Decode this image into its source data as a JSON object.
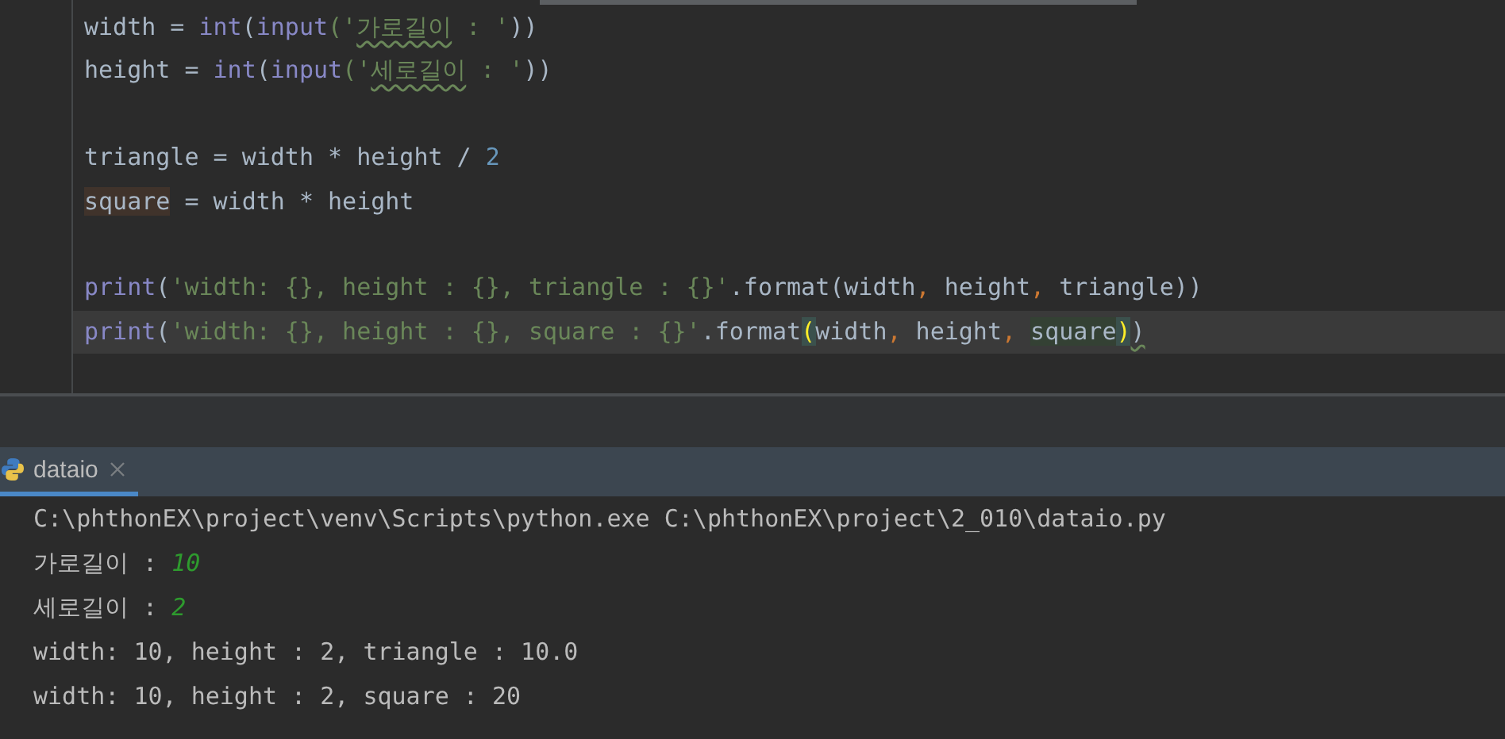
{
  "editor": {
    "blocks": [
      [
        {
          "current": false,
          "tokens": [
            {
              "text": "width",
              "kind": "ident"
            },
            {
              "text": " = ",
              "kind": "ident"
            },
            {
              "text": "int",
              "kind": "builtin"
            },
            {
              "text": "(",
              "kind": "ident"
            },
            {
              "text": "input",
              "kind": "builtin"
            },
            {
              "text": "('",
              "kind": "str"
            },
            {
              "text": "가로길이",
              "kind": "typo"
            },
            {
              "text": " : '",
              "kind": "str"
            },
            {
              "text": "))",
              "kind": "ident"
            }
          ]
        },
        {
          "current": false,
          "tokens": [
            {
              "text": "height",
              "kind": "ident"
            },
            {
              "text": " = ",
              "kind": "ident"
            },
            {
              "text": "int",
              "kind": "builtin"
            },
            {
              "text": "(",
              "kind": "ident"
            },
            {
              "text": "input",
              "kind": "builtin"
            },
            {
              "text": "('",
              "kind": "str"
            },
            {
              "text": "세로길이",
              "kind": "typo"
            },
            {
              "text": " : '",
              "kind": "str"
            },
            {
              "text": "))",
              "kind": "ident"
            }
          ]
        }
      ],
      [
        {
          "current": false,
          "tokens": [
            {
              "text": "triangle = width * height / ",
              "kind": "ident"
            },
            {
              "text": "2",
              "kind": "num"
            }
          ]
        },
        {
          "current": false,
          "tokens": [
            {
              "text": "square",
              "kind": "write"
            },
            {
              "text": " = width * height",
              "kind": "ident"
            }
          ]
        }
      ],
      [
        {
          "current": false,
          "tokens": [
            {
              "text": "print",
              "kind": "builtin"
            },
            {
              "text": "(",
              "kind": "ident"
            },
            {
              "text": "'width: {}, height : {}, triangle : {}'",
              "kind": "str"
            },
            {
              "text": ".format(width",
              "kind": "ident"
            },
            {
              "text": ", ",
              "kind": "comma"
            },
            {
              "text": "height",
              "kind": "ident"
            },
            {
              "text": ", ",
              "kind": "comma"
            },
            {
              "text": "triangle))",
              "kind": "ident"
            }
          ]
        },
        {
          "current": true,
          "tokens": [
            {
              "text": "print",
              "kind": "builtin"
            },
            {
              "text": "(",
              "kind": "ident"
            },
            {
              "text": "'width: {}, height : {}, square : {}'",
              "kind": "str"
            },
            {
              "text": ".format",
              "kind": "ident"
            },
            {
              "text": "(",
              "kind": "brace"
            },
            {
              "text": "width",
              "kind": "ident"
            },
            {
              "text": ", ",
              "kind": "comma"
            },
            {
              "text": "height",
              "kind": "ident"
            },
            {
              "text": ", ",
              "kind": "comma"
            },
            {
              "text": "square",
              "kind": "read"
            },
            {
              "text": ")",
              "kind": "brace"
            },
            {
              "text": ")",
              "kind": "warn"
            }
          ]
        }
      ]
    ]
  },
  "run_panel": {
    "tabs": [
      {
        "label": "dataio",
        "selected": true
      }
    ],
    "console": [
      [
        {
          "text": "C:\\phthonEX\\project\\venv\\Scripts\\python.exe C:\\phthonEX\\project\\2_010\\dataio.py",
          "kind": "output"
        }
      ],
      [
        {
          "text": "가로길이 : ",
          "kind": "output"
        },
        {
          "text": "10",
          "kind": "input"
        }
      ],
      [
        {
          "text": "세로길이 : ",
          "kind": "output"
        },
        {
          "text": "2",
          "kind": "input"
        }
      ],
      [
        {
          "text": "width: 10, height : 2, triangle : 10.0",
          "kind": "output"
        }
      ],
      [
        {
          "text": "width: 10, height : 2, square : 20",
          "kind": "output"
        }
      ]
    ]
  }
}
